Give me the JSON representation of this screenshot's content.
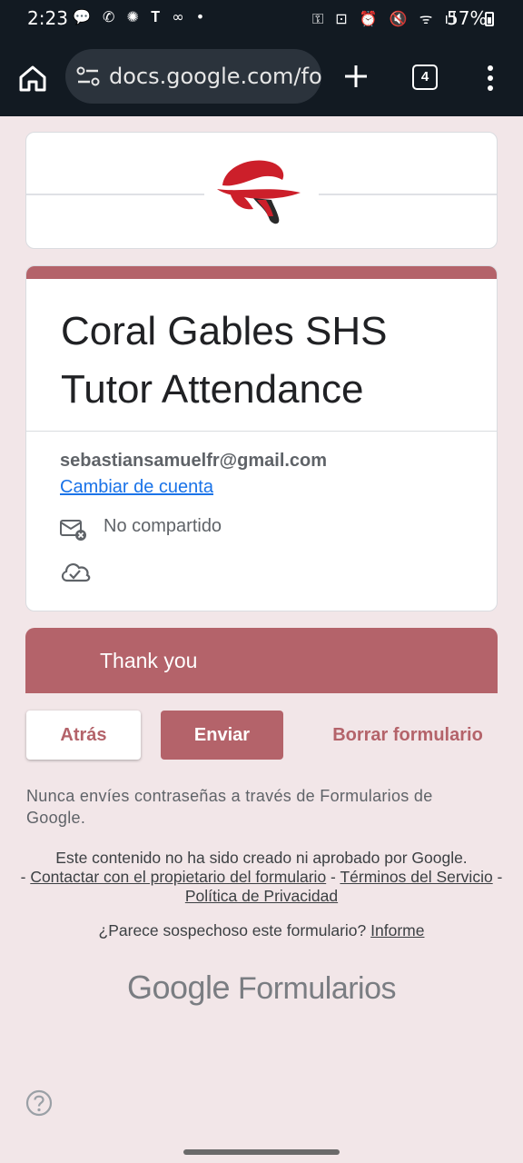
{
  "status_bar": {
    "time": "2:23",
    "left_icons": "💬 ✆ ✺ 𝐓 ∞ •",
    "right_icons": "⚿ ⊡ ⏰ 🔇 ᯤ ıl",
    "battery": "57%"
  },
  "browser": {
    "url": "docs.google.com/fo",
    "tab_count": "4"
  },
  "form": {
    "title": "Coral Gables SHS Tutor Attendance",
    "email": "sebastiansamuelfr@gmail.com",
    "switch_account": "Cambiar de cuenta",
    "not_shared": "No compartido",
    "section_title": "Thank you",
    "accent_color": "#b4636a"
  },
  "buttons": {
    "back": "Atrás",
    "submit": "Enviar",
    "clear": "Borrar formulario"
  },
  "footer": {
    "never_passwords": "Nunca envíes contraseñas a través de Formularios de Google.",
    "disclaimer_line": "Este contenido no ha sido creado ni aprobado por Google.",
    "contact_owner": "Contactar con el propietario del formulario",
    "terms": "Términos del Servicio",
    "privacy": "Política de Privacidad",
    "suspicious": "¿Parece sospechoso este formulario?",
    "report": "Informe",
    "brand_google": "Google",
    "brand_forms": "Formularios"
  }
}
